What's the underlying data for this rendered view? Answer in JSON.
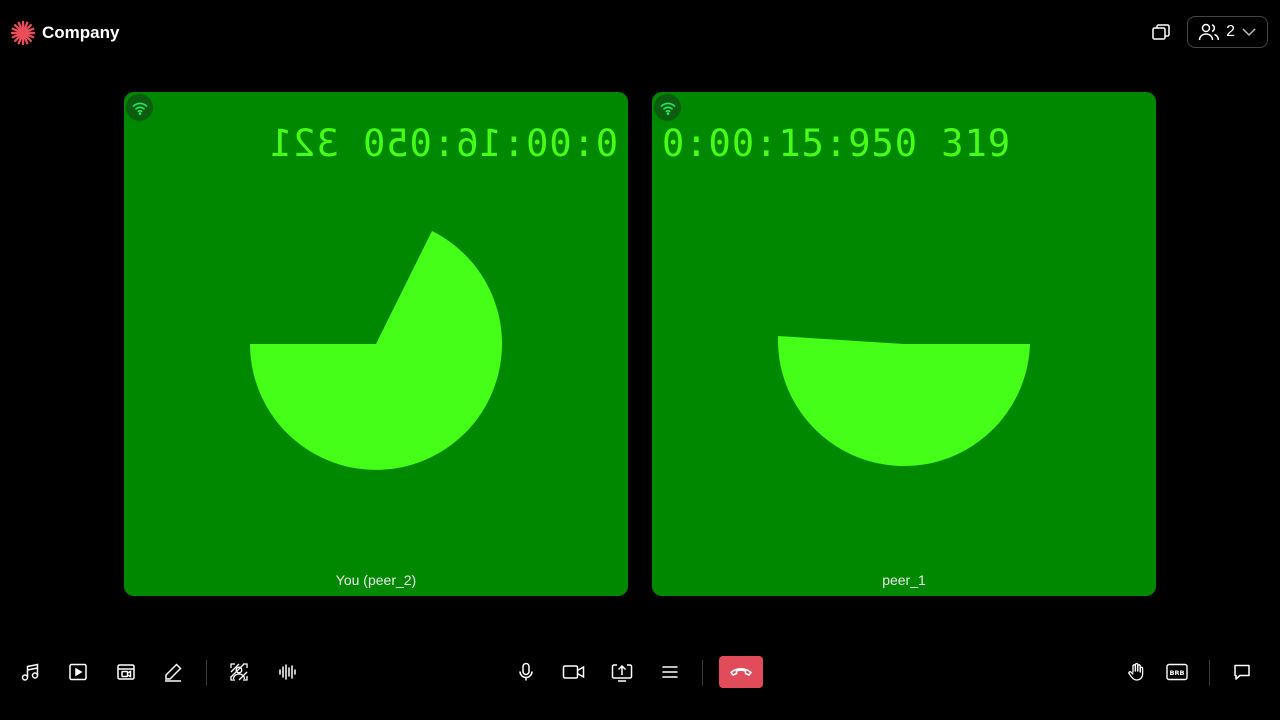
{
  "app": {
    "brand_name": "Company",
    "brand_color": "#e94d59"
  },
  "header": {
    "peer_count": "2",
    "icons": [
      "pip-icon",
      "participants-icon",
      "chevron-down-icon"
    ]
  },
  "tiles": [
    {
      "peer_label": "You (peer_2)",
      "timecode": "0:00:16:050 321",
      "mirrored": true,
      "background": "#008800",
      "shape_color": "#46ff18"
    },
    {
      "peer_label": "peer_1",
      "timecode": "0:00:15:950 319",
      "mirrored": false,
      "background": "#008800",
      "shape_color": "#46ff18"
    }
  ],
  "toolbar": {
    "left_icons": [
      "music-icon",
      "video-play-icon",
      "video-share-icon",
      "whiteboard-icon",
      "virtual-background-icon",
      "noise-suppression-icon"
    ],
    "center_icons": [
      "microphone-icon",
      "camera-icon",
      "screenshare-icon",
      "more-options-icon"
    ],
    "leave_color": "#e24c5a",
    "right_icons": [
      "hand-raise-icon",
      "brb-icon",
      "chat-icon"
    ],
    "brb_label": "BRB"
  }
}
